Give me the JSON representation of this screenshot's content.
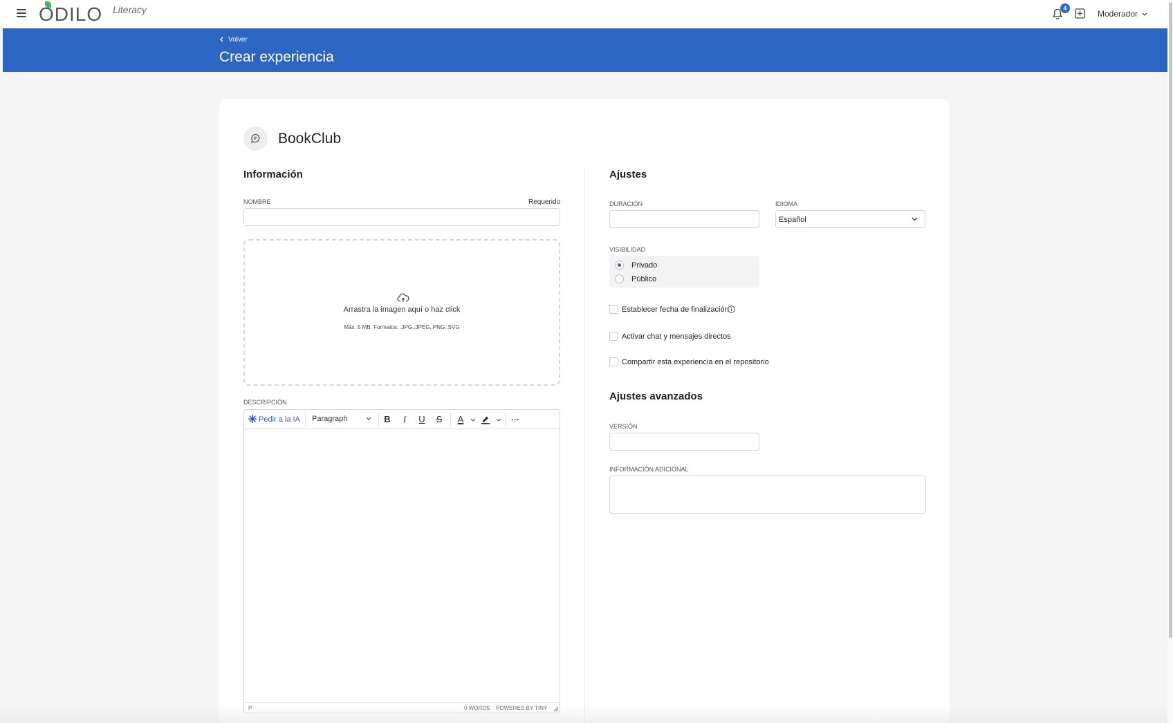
{
  "header": {
    "logo_text": "ODILO",
    "logo_sub": "Literacy",
    "notifications_count": "4",
    "user_label": "Moderador"
  },
  "banner": {
    "back_label": "Volver",
    "title": "Crear experiencia"
  },
  "experience": {
    "name": "BookClub"
  },
  "info": {
    "section_title": "Información",
    "name_label": "NOMBRE",
    "required_label": "Requerido",
    "name_value": "",
    "dropzone_text": "Arrastra la imagen aquí o haz click",
    "dropzone_hint": "Máx. 5 MB. Formatos: .JPG,.JPEG,.PNG,.SVG",
    "description_label": "DESCRIPCIÓN"
  },
  "editor": {
    "ai_label": "Pedir a la IA",
    "format_value": "Paragraph",
    "bold": "B",
    "italic": "I",
    "underline": "U",
    "strike": "S",
    "text_color": "A",
    "more": "···",
    "status_path": "P",
    "status_words": "0 WORDS",
    "status_powered": "POWERED BY TINY"
  },
  "settings": {
    "section_title": "Ajustes",
    "duration_label": "DURACIÓN",
    "duration_value": "",
    "language_label": "IDIOMA",
    "language_value": "Español",
    "visibility_label": "VISIBILIDAD",
    "visibility_options": [
      "Privado",
      "Público"
    ],
    "visibility_selected": "Privado",
    "checkbox_end_date": "Establecer fecha de finalización",
    "checkbox_chat": "Activar chat y mensajes directos",
    "checkbox_share": "Compartir esta experiencia en el repositorio"
  },
  "advanced": {
    "section_title": "Ajustes avanzados",
    "version_label": "VERSIÓN",
    "version_value": "",
    "extra_info_label": "INFORMACIÓN ADICIONAL",
    "extra_info_value": ""
  },
  "colors": {
    "brand_blue": "#2c66c2",
    "logo_green": "#3cb84a"
  }
}
